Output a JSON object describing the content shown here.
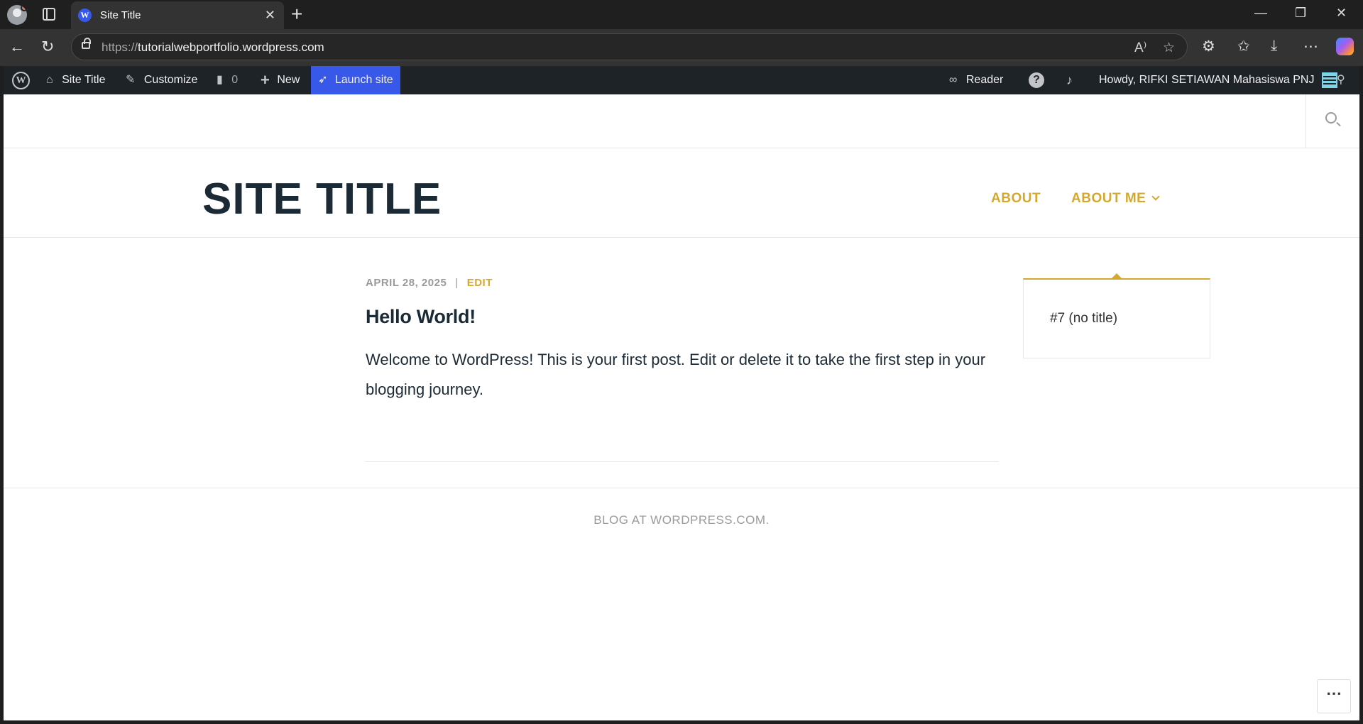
{
  "browser": {
    "tab_title": "Site Title",
    "tab_favicon": "W",
    "url_scheme": "https://",
    "url_host": "tutorialwebportfolio.wordpress.com",
    "window_controls": [
      "—",
      "❐",
      "✕"
    ]
  },
  "adminbar": {
    "site_title": "Site Title",
    "customize": "Customize",
    "comments_count": "0",
    "new": "New",
    "launch": "Launch site",
    "reader": "Reader",
    "howdy": "Howdy, RIFKI SETIAWAN Mahasiswa PNJ"
  },
  "site": {
    "title": "SITE TITLE",
    "menu": [
      "ABOUT",
      "ABOUT ME"
    ],
    "dropdown_item": "#7 (no title)"
  },
  "post": {
    "date": "APRIL 28, 2025",
    "separator": "|",
    "edit": "EDIT",
    "title": "Hello World!",
    "body": "Welcome to WordPress! This is your first post. Edit or delete it to take the first step in your blogging journey."
  },
  "footer": {
    "text": "BLOG AT WORDPRESS.COM."
  },
  "colors": {
    "accent": "#d4a82f",
    "adminbar": "#1d2327",
    "launch": "#3858e9",
    "title": "#1c2a35"
  }
}
